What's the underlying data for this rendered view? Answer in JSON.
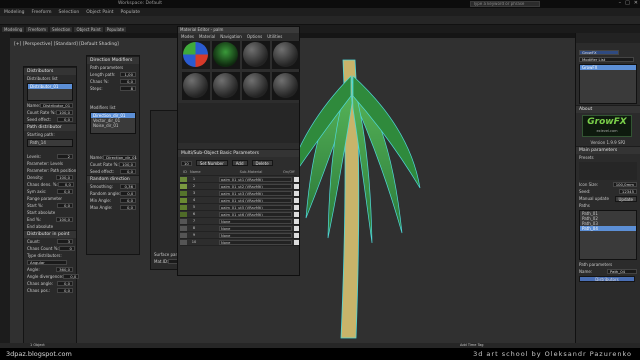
{
  "window": {
    "title": "Workspace: Default",
    "search_placeholder": "Type a keyword or phrase"
  },
  "menubar": [
    "Modeling",
    "Freeform",
    "Selection",
    "Object Paint",
    "Populate"
  ],
  "ribbon": [
    "Modeling",
    "Freeform",
    "Selection",
    "Object Paint",
    "Populate"
  ],
  "viewport": {
    "label": "[+] [Perspective] [Standard] [Default Shading]"
  },
  "panel_distributors": {
    "title": "Distributors",
    "list_label": "Distributors list",
    "items": [
      "Distributor_01"
    ],
    "name_label": "Name:",
    "name_value": "Distributor_01",
    "count_label": "Count Rate %:",
    "count_value": "100,0",
    "seed_label": "Seed effect:",
    "seed_value": "0,0",
    "path_section": "Path distributor",
    "starting_path": "Starting path:",
    "path_items": [
      "Path_14"
    ],
    "levels_label": "Levels:",
    "levels_value": "2",
    "param_label": "Parameter: Levels",
    "param_path_label": "Parameter: Path position",
    "density_label": "Density:",
    "density_value": "100,0",
    "chaos_label": "Chaos dens. %:",
    "chaos_value": "0,0",
    "sym_label": "Sym axis:",
    "sym_value": "0,0",
    "range_label": "Range parameter",
    "start_label": "Start %:",
    "start_value": "0,0",
    "start_abs": "Start absolute",
    "end_label": "End %:",
    "end_value": "100,0",
    "end_abs": "End absolute",
    "point_section": "Distributor in point",
    "count2_label": "Count:",
    "count2_value": "3",
    "chaos_count_label": "Chaos Count %:",
    "chaos_count_value": "0",
    "type_label": "Type distributors:",
    "type_value": "Angular",
    "angle_label": "Angle:",
    "angle_value": "360,0",
    "angle_div_label": "Angle divergence:",
    "angle_div_value": "0,0",
    "chaos_angle_label": "Chaos angle:",
    "chaos_angle_value": "0,0",
    "chaos_pos_label": "Chaos pos.:",
    "chaos_pos_value": "0,0"
  },
  "panel_direction": {
    "title": "Direction Modifiers",
    "path_params": "Path parameters",
    "length_label": "Length path:",
    "length_value": "1,00",
    "chaos_label": "Chaos %:",
    "chaos_value": "0,0",
    "steps_label": "Steps:",
    "steps_value": "8",
    "modifiers_label": "Modifiers list",
    "modifiers": [
      "Direction_dir_01",
      "Vector_dir_01",
      "Noise_dir_01"
    ],
    "name_label": "Name:",
    "name_value": "Direction_dir_01",
    "count_label": "Count Rate %:",
    "count_value": "100,0",
    "seed_label": "Seed effect:",
    "seed_value": "0,0",
    "random_section": "Random direction",
    "smooth_label": "Smoothing:",
    "smooth_value": "0,36",
    "random_label": "Random angle:",
    "random_value": "0,0",
    "min_label": "Min Angle:",
    "min_value": "0,0",
    "max_label": "Max Angle:",
    "max_value": "0,0"
  },
  "material_editor": {
    "title": "Material Editor - palm",
    "menu": [
      "Modes",
      "Material",
      "Navigation",
      "Options",
      "Utilities"
    ],
    "section": "Multi/Sub-Object Basic Parameters",
    "set_number": "Set Number",
    "add": "Add",
    "delete": "Delete",
    "count_label": "10",
    "columns": [
      "ID",
      "Name",
      "Sub-Material",
      "On/Off"
    ],
    "rows": [
      {
        "id": "1",
        "name": "",
        "sub": "palm_01_ut1 (VRayMtl)",
        "color": "#6b8a3a"
      },
      {
        "id": "2",
        "name": "",
        "sub": "palm_01_ut2 (VRayMtl)",
        "color": "#7a9a40"
      },
      {
        "id": "3",
        "name": "",
        "sub": "palm_01_ut3 (VRayMtl)",
        "color": "#55742c"
      },
      {
        "id": "4",
        "name": "",
        "sub": "palm_01_ut4 (VRayMtl)",
        "color": "#6a8a32"
      },
      {
        "id": "5",
        "name": "",
        "sub": "palm_01_ut5 (VRayMtl)",
        "color": "#5e7e2e"
      },
      {
        "id": "6",
        "name": "",
        "sub": "palm_01_ut6 (VRayMtl)",
        "color": "#4f6b28"
      },
      {
        "id": "7",
        "name": "",
        "sub": "None",
        "color": "#555555"
      },
      {
        "id": "8",
        "name": "",
        "sub": "None",
        "color": "#555555"
      },
      {
        "id": "9",
        "name": "",
        "sub": "None",
        "color": "#555555"
      },
      {
        "id": "10",
        "name": "",
        "sub": "None",
        "color": "#555555"
      }
    ]
  },
  "left_panel_extra": {
    "surface_label": "Surface parameters",
    "matid_label": "Mat.ID:",
    "matid_value": "1"
  },
  "command_panel": {
    "object_name": "GrowFX",
    "modifier_list": "Modifier List",
    "stack_item": "GrowFX",
    "about": "About",
    "logo_text": "GrowFX",
    "logo_sub": "exlevel.com",
    "version": "Version 1.9.9 SP2",
    "main_params": "Main parameters",
    "presets": "Presets",
    "icon_size_label": "Icon Size:",
    "icon_size_value": "100,0mm",
    "seed_label": "Seed:",
    "seed_value": "12345",
    "manual_update": "Manual update",
    "update": "Update",
    "paths_label": "Paths",
    "paths": [
      "Path_01",
      "Path_02",
      "Path_03",
      "Path_04"
    ],
    "path_params": "Path parameters",
    "name_label": "Name:",
    "name_value": "Path_04",
    "distributors_btn": "Distributors"
  },
  "status": {
    "selected": "1 Object Selected",
    "add_time_tag": "Add Time Tag",
    "objects": "1 Object"
  },
  "footer": {
    "left": "3dpaz.blogspot.com",
    "right": "3d art school by Oleksandr Pazurenko"
  },
  "colors": {
    "selection": "#5c8fd6",
    "palm_green": "#3f9b4a",
    "wire_cyan": "#4fd8d8",
    "logo_green": "#7bd14a"
  }
}
